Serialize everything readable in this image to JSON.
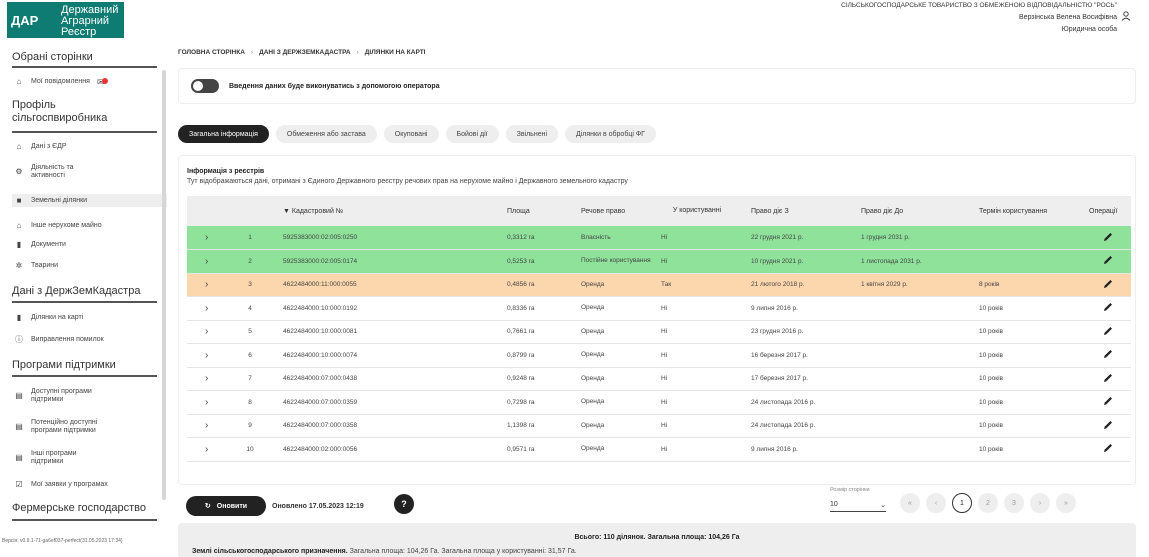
{
  "logo": {
    "mark": "ДАР",
    "line1": "Державний",
    "line2": "Аграрний",
    "line3": "Реєстр"
  },
  "header": {
    "organization": "СІЛЬСЬКОГОСПОДАРСЬКЕ ТОВАРИСТВО З ОБМЕЖЕНОЮ ВІДПОВІДАЛЬНІСТЮ \"РОСЬ\"",
    "user_name": "Верзінська Велена Восифівна",
    "user_role": "Юридична особа"
  },
  "sidebar": {
    "sections": [
      {
        "title": "Обрані сторінки",
        "items": [
          {
            "label": "Мої повідомлення",
            "icon": "home-icon"
          }
        ]
      },
      {
        "title": "Профіль сільгоспвиробника",
        "items": [
          {
            "label": "Дані з ЄДР",
            "icon": "bank-icon"
          },
          {
            "label": "Діяльність та активності",
            "icon": "tractor-icon"
          },
          {
            "label": "Земельні ділянки",
            "icon": "land-icon"
          },
          {
            "label": "Інше нерухоме майно",
            "icon": "house-icon"
          },
          {
            "label": "Документи",
            "icon": "document-icon"
          },
          {
            "label": "Тварини",
            "icon": "animal-icon"
          }
        ]
      },
      {
        "title": "Дані з ДержЗемКадастра",
        "items": [
          {
            "label": "Ділянки на карті",
            "icon": "map-icon"
          },
          {
            "label": "Виправлення помилок",
            "icon": "info-icon"
          }
        ]
      },
      {
        "title": "Програми підтримки",
        "items": [
          {
            "label": "Доступні програми підтримки",
            "icon": "clipboard-icon"
          },
          {
            "label": "Потенційно доступні програми підтримки",
            "icon": "clipboard-icon"
          },
          {
            "label": "Інші програми підтримки",
            "icon": "clipboard-icon"
          },
          {
            "label": "Мої заявки у програмах",
            "icon": "check-icon"
          }
        ]
      },
      {
        "title": "Фермерське господарство",
        "items": []
      }
    ],
    "version": "Версія: v0.9.1-71-ga6ef037-perfect(31.05.2023 17:34)"
  },
  "breadcrumb": [
    "ГОЛОВНА СТОРІНКА",
    "ДАНІ З ДЕРЖЗЕМКАДАСТРА",
    "ДІЛЯНКИ НА КАРТІ"
  ],
  "operator": {
    "label": "Введення даних буде виконуватись з допомогою оператора"
  },
  "tabs": [
    "Загальна інформація",
    "Обмеження або застава",
    "Окуповані",
    "Бойові дії",
    "Звільнені",
    "Ділянки в обробці ФГ"
  ],
  "info": {
    "title": "Інформація з реєстрів",
    "subtitle": "Тут відображаються дані, отримані з Єдиного Державного реєстру речових прав на нерухоме майно і Державного земельного кадастру"
  },
  "table": {
    "headers": [
      "",
      "",
      "▼ Кадастровий №",
      "Площа",
      "Речове право",
      "У користуванні",
      "Право діє З",
      "Право діє До",
      "Термін користування",
      "Операції"
    ],
    "rows": [
      {
        "n": "1",
        "cad": "5925383000:02:005:0250",
        "area": "0,3312 га",
        "right": "Власність",
        "use": "Ні",
        "from": "22 грудня 2021 р.",
        "to": "1 грудня 2031 р.",
        "term": "",
        "style": "g"
      },
      {
        "n": "2",
        "cad": "5925383000:02:005:0174",
        "area": "0,5253 га",
        "right": "Постійне користування",
        "use": "Ні",
        "from": "10 грудня 2021 р.",
        "to": "1 листопада 2031 р.",
        "term": "",
        "style": "g"
      },
      {
        "n": "3",
        "cad": "4622484000:11:000:0055",
        "area": "0,4856 га",
        "right": "Оренда",
        "use": "Так",
        "from": "21 лютого 2018 р.",
        "to": "1 квітня 2029 р.",
        "term": "8 років",
        "style": "o"
      },
      {
        "n": "4",
        "cad": "4622484000:10:000:0192",
        "area": "0,8336 га",
        "right": "Оренда",
        "use": "Ні",
        "from": "9 липня 2016 р.",
        "to": "",
        "term": "10 років",
        "style": ""
      },
      {
        "n": "5",
        "cad": "4622484000:10:000:0081",
        "area": "0,7661 га",
        "right": "Оренда",
        "use": "Ні",
        "from": "23 грудня 2016 р.",
        "to": "",
        "term": "10 років",
        "style": ""
      },
      {
        "n": "6",
        "cad": "4622484000:10:000:0074",
        "area": "0,8799 га",
        "right": "Оренда",
        "use": "Ні",
        "from": "16 березня 2017 р.",
        "to": "",
        "term": "10 років",
        "style": ""
      },
      {
        "n": "7",
        "cad": "4622484000:07:000:0438",
        "area": "0,9248 га",
        "right": "Оренда",
        "use": "Ні",
        "from": "17 березня 2017 р.",
        "to": "",
        "term": "10 років",
        "style": ""
      },
      {
        "n": "8",
        "cad": "4622484000:07:000:0359",
        "area": "0,7298 га",
        "right": "Оренда",
        "use": "Ні",
        "from": "24 листопада 2016 р.",
        "to": "",
        "term": "10 років",
        "style": ""
      },
      {
        "n": "9",
        "cad": "4622484000:07:000:0358",
        "area": "1,1398 га",
        "right": "Оренда",
        "use": "Ні",
        "from": "24 листопада 2016 р.",
        "to": "",
        "term": "10 років",
        "style": ""
      },
      {
        "n": "10",
        "cad": "4622484000:02:000:0056",
        "area": "0,9571 га",
        "right": "Оренда",
        "use": "Ні",
        "from": "9 липня 2016 р.",
        "to": "",
        "term": "10 років",
        "style": ""
      }
    ]
  },
  "footer": {
    "refresh_label": "Оновити",
    "updated": "Оновлено 17.05.2023 12:19",
    "help": "?",
    "page_size_label": "Розмір сторінки",
    "page_size": "10",
    "pages": [
      "«",
      "‹",
      "1",
      "2",
      "3",
      "›",
      "»"
    ],
    "active_page": "1"
  },
  "summary": {
    "total": "Всього: 110 ділянок. Загальна площа: 104,26 Га",
    "agri_bold": "Землі сільськогосподарського призначення.",
    "agri_rest": "Загальна площа: 104,26 Га. Загальна площа у користуванні: 31,57 Га."
  },
  "colors": {
    "accent": "#0e7c73",
    "green_row": "#8ee29a",
    "orange_row": "#fcd6ad",
    "dark": "#222222"
  }
}
